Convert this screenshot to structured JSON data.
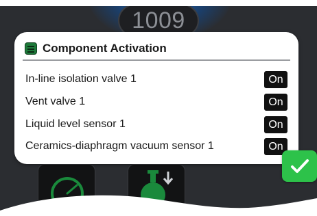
{
  "background": {
    "gauge_value": "1009"
  },
  "dialog": {
    "title": "Component Activation",
    "icon": "list-icon",
    "rows": [
      {
        "label": "In-line isolation valve 1",
        "state": "On"
      },
      {
        "label": "Vent valve 1",
        "state": "On"
      },
      {
        "label": "Liquid level sensor 1",
        "state": "On"
      },
      {
        "label": "Ceramics-diaphragm vacuum sensor 1",
        "state": "On"
      }
    ]
  },
  "confirm": {
    "icon": "checkmark-icon"
  },
  "tiles": [
    {
      "icon": "gauge-icon"
    },
    {
      "icon": "flask-down-arrow-icon"
    }
  ],
  "colors": {
    "accent_green": "#2dc24a",
    "icon_green": "#1e7a3a",
    "screen_bg": "#2b2d31",
    "toggle_bg": "#111111"
  }
}
